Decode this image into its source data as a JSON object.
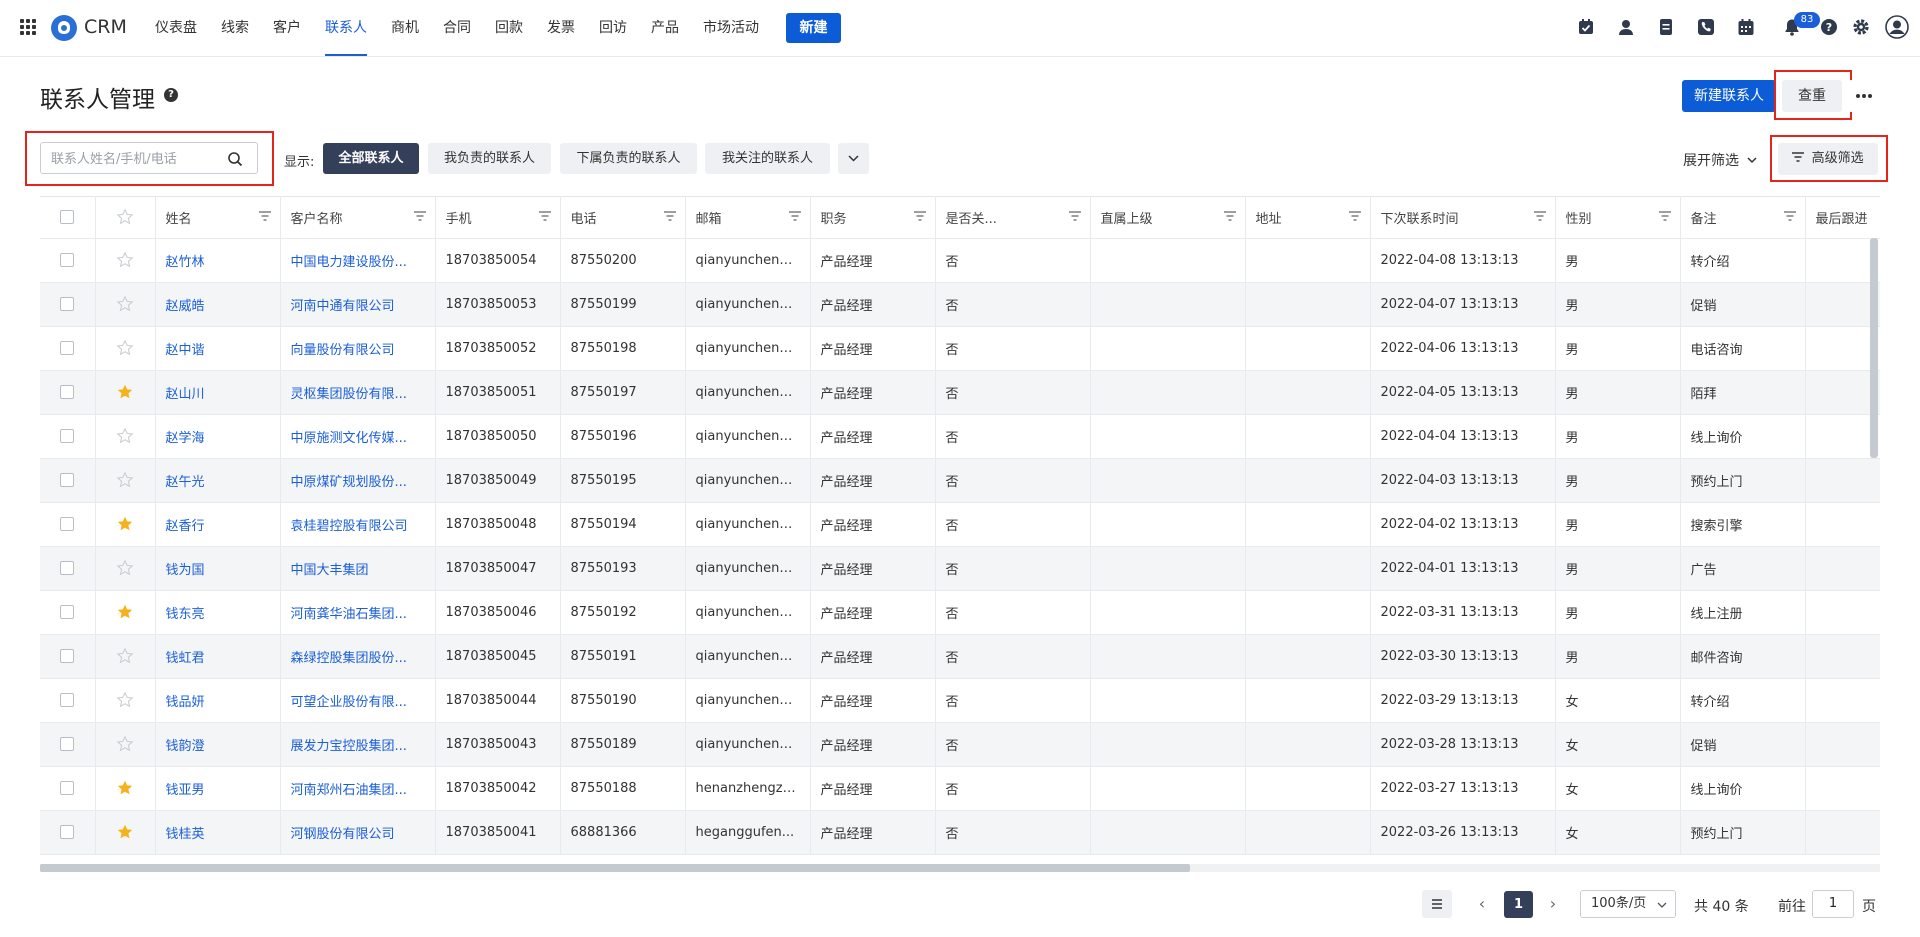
{
  "nav": {
    "brand": "CRM",
    "items": [
      "仪表盘",
      "线索",
      "客户",
      "联系人",
      "商机",
      "合同",
      "回款",
      "发票",
      "回访",
      "产品",
      "市场活动"
    ],
    "active_index": 3,
    "new_label": "新建",
    "notification_count": "83",
    "icons": [
      "task-icon",
      "user-icon",
      "note-icon",
      "phone-icon",
      "calendar-icon",
      "bell-icon",
      "help-icon",
      "settings-icon",
      "avatar-icon"
    ]
  },
  "header": {
    "title": "联系人管理",
    "new_contact_label": "新建联系人",
    "dedupe_label": "查重"
  },
  "filters": {
    "search_placeholder": "联系人姓名/手机/电话",
    "show_label": "显示:",
    "segments": [
      "全部联系人",
      "我负责的联系人",
      "下属负责的联系人",
      "我关注的联系人"
    ],
    "active_segment": 0,
    "expand_label": "展开筛选",
    "advanced_label": "高级筛选"
  },
  "table": {
    "columns": [
      "姓名",
      "客户名称",
      "手机",
      "电话",
      "邮箱",
      "职务",
      "是否关...",
      "直属上级",
      "地址",
      "下次联系时间",
      "性别",
      "备注",
      "最后跟进"
    ],
    "rows": [
      {
        "starred": false,
        "cells": [
          "赵竹林",
          "中国电力建设股份...",
          "18703850054",
          "87550200",
          "qianyuncheng...",
          "产品经理",
          "否",
          "",
          "",
          "2022-04-08 13:13:13",
          "男",
          "转介绍",
          ""
        ]
      },
      {
        "starred": false,
        "cells": [
          "赵威皓",
          "河南中通有限公司",
          "18703850053",
          "87550199",
          "qianyuncheng...",
          "产品经理",
          "否",
          "",
          "",
          "2022-04-07 13:13:13",
          "男",
          "促销",
          ""
        ]
      },
      {
        "starred": false,
        "cells": [
          "赵中谐",
          "向量股份有限公司",
          "18703850052",
          "87550198",
          "qianyuncheng...",
          "产品经理",
          "否",
          "",
          "",
          "2022-04-06 13:13:13",
          "男",
          "电话咨询",
          ""
        ]
      },
      {
        "starred": true,
        "cells": [
          "赵山川",
          "灵枢集团股份有限...",
          "18703850051",
          "87550197",
          "qianyuncheng...",
          "产品经理",
          "否",
          "",
          "",
          "2022-04-05 13:13:13",
          "男",
          "陌拜",
          ""
        ]
      },
      {
        "starred": false,
        "cells": [
          "赵学海",
          "中原施测文化传媒...",
          "18703850050",
          "87550196",
          "qianyuncheng...",
          "产品经理",
          "否",
          "",
          "",
          "2022-04-04 13:13:13",
          "男",
          "线上询价",
          ""
        ]
      },
      {
        "starred": false,
        "cells": [
          "赵午光",
          "中原煤矿规划股份...",
          "18703850049",
          "87550195",
          "qianyuncheng...",
          "产品经理",
          "否",
          "",
          "",
          "2022-04-03 13:13:13",
          "男",
          "预约上门",
          ""
        ]
      },
      {
        "starred": true,
        "cells": [
          "赵香行",
          "袁桂碧控股有限公司",
          "18703850048",
          "87550194",
          "qianyuncheng...",
          "产品经理",
          "否",
          "",
          "",
          "2022-04-02 13:13:13",
          "男",
          "搜索引擎",
          ""
        ]
      },
      {
        "starred": false,
        "cells": [
          "钱为国",
          "中国大丰集团",
          "18703850047",
          "87550193",
          "qianyuncheng...",
          "产品经理",
          "否",
          "",
          "",
          "2022-04-01 13:13:13",
          "男",
          "广告",
          ""
        ]
      },
      {
        "starred": true,
        "cells": [
          "钱东亮",
          "河南龚华油石集团...",
          "18703850046",
          "87550192",
          "qianyuncheng...",
          "产品经理",
          "否",
          "",
          "",
          "2022-03-31 13:13:13",
          "男",
          "线上注册",
          ""
        ]
      },
      {
        "starred": false,
        "cells": [
          "钱虹君",
          "森绿控股集团股份...",
          "18703850045",
          "87550191",
          "qianyuncheng...",
          "产品经理",
          "否",
          "",
          "",
          "2022-03-30 13:13:13",
          "男",
          "邮件咨询",
          ""
        ]
      },
      {
        "starred": false,
        "cells": [
          "钱品妍",
          "可望企业股份有限...",
          "18703850044",
          "87550190",
          "qianyuncheng...",
          "产品经理",
          "否",
          "",
          "",
          "2022-03-29 13:13:13",
          "女",
          "转介绍",
          ""
        ]
      },
      {
        "starred": false,
        "cells": [
          "钱韵澄",
          "展发力宝控股集团...",
          "18703850043",
          "87550189",
          "qianyuncheng...",
          "产品经理",
          "否",
          "",
          "",
          "2022-03-28 13:13:13",
          "女",
          "促销",
          ""
        ]
      },
      {
        "starred": true,
        "cells": [
          "钱亚男",
          "河南郑州石油集团...",
          "18703850042",
          "87550188",
          "henanzhengzh...",
          "产品经理",
          "否",
          "",
          "",
          "2022-03-27 13:13:13",
          "女",
          "线上询价",
          ""
        ]
      },
      {
        "starred": true,
        "cells": [
          "钱桂英",
          "河钢股份有限公司",
          "18703850041",
          "68881366",
          "heganggufen...",
          "产品经理",
          "否",
          "",
          "",
          "2022-03-26 13:13:13",
          "女",
          "预约上门",
          ""
        ]
      }
    ]
  },
  "pagination": {
    "current_page": "1",
    "page_size": "100条/页",
    "total": "共 40 条",
    "goto_label": "前往",
    "goto_value": "1",
    "unit": "页"
  },
  "colors": {
    "primary": "#0b5cd6",
    "link": "#1a5ed8",
    "active_segment": "#34405a",
    "star": "#f5b21a",
    "highlight_box": "#e5251a"
  }
}
